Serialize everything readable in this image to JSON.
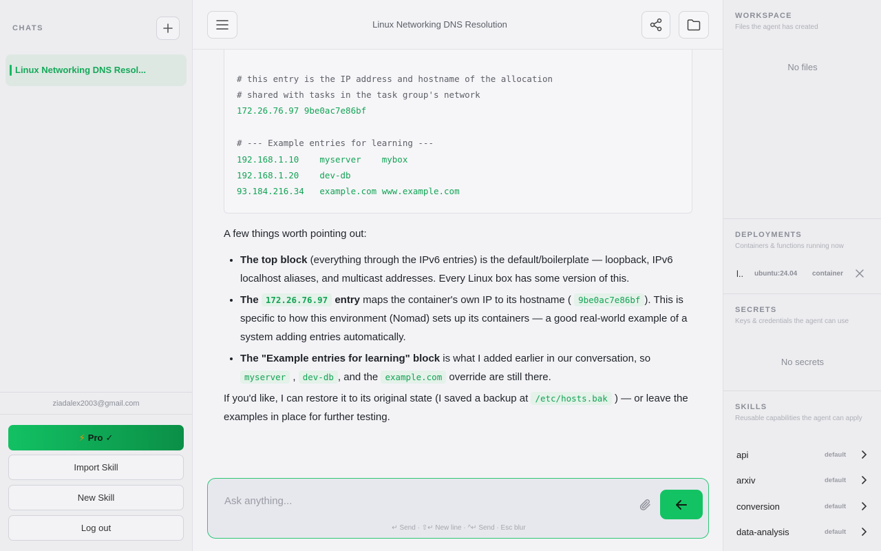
{
  "sidebar": {
    "heading": "CHATS",
    "chats": [
      {
        "label": "Linux Networking DNS Resol..."
      }
    ],
    "email": "ziadalex2003@gmail.com",
    "pro_label": "Pro",
    "import_label": "Import Skill",
    "new_skill_label": "New Skill",
    "logout_label": "Log out"
  },
  "header": {
    "title": "Linux Networking DNS Resolution"
  },
  "code": {
    "lines": [
      "# this entry is the IP address and hostname of the allocation",
      "# shared with tasks in the task group's network",
      "172.26.76.97 9be0ac7e86bf",
      "# --- Example entries for learning ---",
      "192.168.1.10    myserver    mybox",
      "192.168.1.20    dev-db",
      "93.184.216.34   example.com www.example.com"
    ]
  },
  "message": {
    "intro": "A few things worth pointing out:",
    "b1_bold": "The top block",
    "b1_text": " (everything through the IPv6 entries) is the default/boilerplate — loopback, IPv6 localhost aliases, and multicast addresses. Every Linux box has some version of this.",
    "b2_bold1": "The",
    "b2_code": "172.26.76.97",
    "b2_bold2": "entry",
    "b2_text1": " maps the container's own IP to its hostname (",
    "b2_code2": "9be0ac7e86bf",
    "b2_text2": "). This is specific to how this environment (Nomad) sets up its containers — a good real-world example of a system adding entries automatically.",
    "b3_bold": "The \"Example entries for learning\" block",
    "b3_text1": " is what I added earlier in our conversation, so",
    "b3_code1": "myserver",
    "b3_code2": "dev-db",
    "b3_text2": ", and the",
    "b3_code3": "example.com",
    "b3_text3": " override are still there.",
    "outro1": "If you'd like, I can restore it to its original state (I saved a backup at",
    "outro_code": "/etc/hosts.bak",
    "outro2": ") — or leave the examples in place for further testing."
  },
  "composer": {
    "placeholder": "Ask anything...",
    "hint": "↵ Send · ⇧↵ New line · ^↵ Send · Esc blur"
  },
  "right_panel": {
    "workspace_title": "WORKSPACE",
    "workspace_sub": "Files the agent has created",
    "workspace_empty": "No files",
    "deployments_title": "DEPLOYMENTS",
    "deployments_sub": "Containers & functions running now",
    "deployment": {
      "name": "l..",
      "image": "ubuntu:24.04",
      "kind": "container"
    },
    "secrets_title": "SECRETS",
    "secrets_sub": "Keys & credentials the agent can use",
    "secrets_empty": "No secrets",
    "skills_title": "SKILLS",
    "skills_sub": "Reusable capabilities the agent can apply",
    "skills": [
      {
        "name": "api",
        "tag": "default"
      },
      {
        "name": "arxiv",
        "tag": "default"
      },
      {
        "name": "conversion",
        "tag": "default"
      },
      {
        "name": "data-analysis",
        "tag": "default"
      }
    ]
  }
}
